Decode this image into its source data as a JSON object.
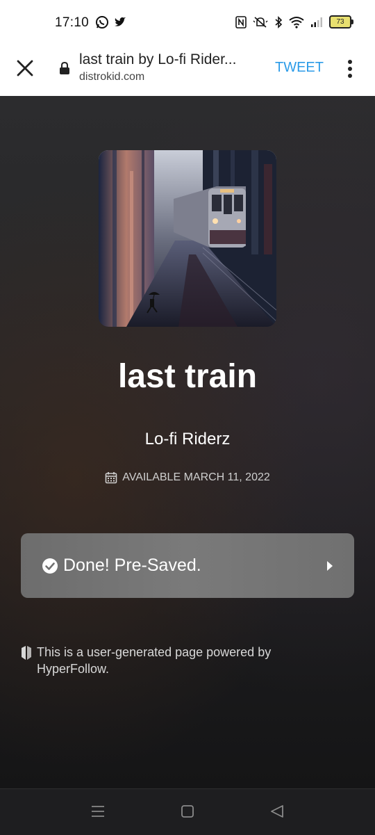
{
  "status_bar": {
    "time": "17:10",
    "battery": "73",
    "left_icons": [
      "whatsapp-icon",
      "twitter-icon"
    ],
    "right_icons": [
      "nfc-icon",
      "mute-icon",
      "bluetooth-icon",
      "wifi-icon",
      "signal-icon",
      "battery-icon"
    ]
  },
  "toolbar": {
    "title": "last train by Lo-fi Rider...",
    "domain": "distrokid.com",
    "tweet_label": "TWEET",
    "accent_color": "#2b9be8"
  },
  "release": {
    "title": "last train",
    "artist": "Lo-fi Riderz",
    "available": "AVAILABLE MARCH 11, 2022"
  },
  "presave": {
    "label": "Done! Pre-Saved."
  },
  "footer": {
    "note": "This is a user-generated page powered by HyperFollow."
  },
  "nav": {
    "items": [
      "recents-icon",
      "home-icon",
      "back-icon"
    ]
  }
}
